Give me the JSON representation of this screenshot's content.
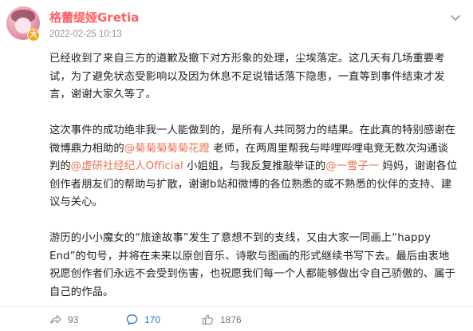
{
  "post": {
    "author": "格蕾缇娅Gretia",
    "timestamp": "2022-02-25 10:13",
    "verified_badge": "大",
    "paragraphs": [
      [
        {
          "text": "已经收到了来自三方的道歉及撤下对方形象的处理，尘埃落定。这几天有几场重要考试，为了避免状态受影响以及因为休息不足说错话落下隐患，一直等到事件结束才发言，谢谢大家久等了。"
        }
      ],
      [
        {
          "text": "这次事件的成功绝非我一人能做到的，是所有人共同努力的结果。在此真的特别感谢在微博鼎力相助的"
        },
        {
          "text": "@菊菊菊菊菊花蹬",
          "mention": true
        },
        {
          "text": " 老师，在两周里帮我与哔哩哔哩电竞无数次沟通谈判的"
        },
        {
          "text": "@虚研社经纪人Official",
          "mention": true
        },
        {
          "text": " 小姐姐，与我反复推敲举证的"
        },
        {
          "text": "@一雪子一",
          "mention": true
        },
        {
          "text": " 妈妈，谢谢各位创作者朋友们的帮助与扩散，谢谢b站和微博的各位熟悉的或不熟悉的伙伴的支持、建议与关心。"
        }
      ],
      [
        {
          "text": "游历的小小魔女的“旅途故事”发生了意想不到的支线，又由大家一同画上“happy End”的句号，并将在未来以原创音乐、诗歌与图画的形式继续书写下去。最后由衷地祝愿创作者们永远不会受到伤害，也祝愿我们每一个人都能够做出令自己骄傲的、属于自己的作品。"
        }
      ]
    ]
  },
  "actions": {
    "share_count": "93",
    "comment_count": "170",
    "like_count": "1876"
  },
  "colors": {
    "author": "#ff5f63",
    "mention": "#eb7350",
    "comment_count": "#1a73c9",
    "muted": "#939393"
  },
  "icons": {
    "more": "chevron-down-icon",
    "share": "share-icon",
    "comment": "comment-icon",
    "like": "thumbs-up-icon"
  }
}
